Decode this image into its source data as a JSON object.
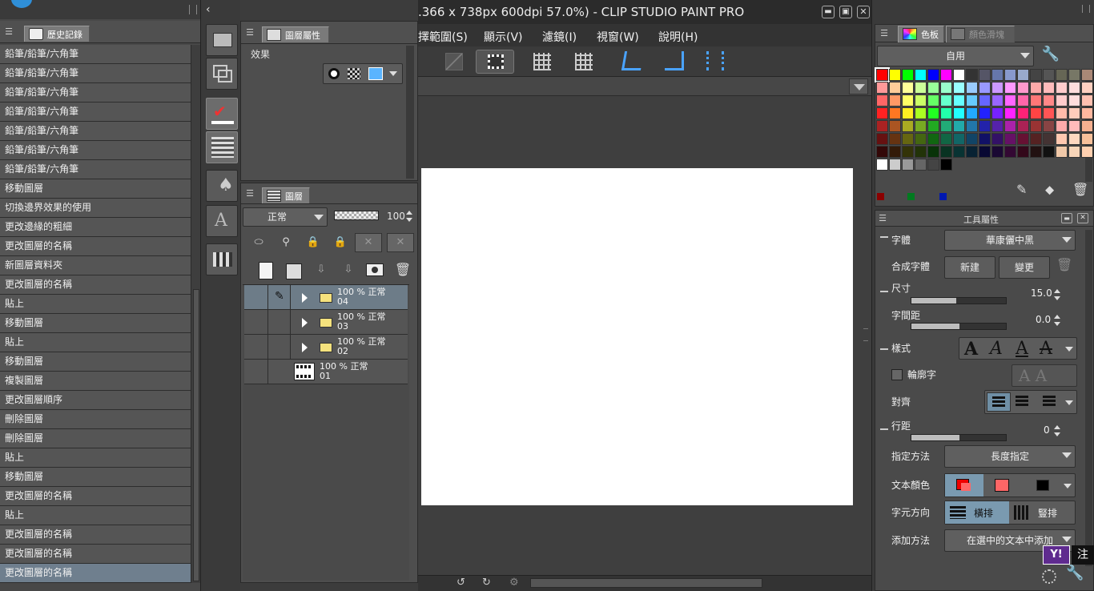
{
  "window": {
    "title": "(1366 x 738px 600dpi 57.0%) - CLIP STUDIO PAINT PRO",
    "title_visible": ".366 x 738px 600dpi 57.0%) - CLIP STUDIO PAINT PRO"
  },
  "menu": [
    "擇範圍(S)",
    "顯示(V)",
    "濾鏡(I)",
    "視窗(W)",
    "說明(H)"
  ],
  "history": {
    "tab_label": "歷史記錄",
    "items": [
      "鉛筆/鉛筆/六角筆",
      "鉛筆/鉛筆/六角筆",
      "鉛筆/鉛筆/六角筆",
      "鉛筆/鉛筆/六角筆",
      "鉛筆/鉛筆/六角筆",
      "鉛筆/鉛筆/六角筆",
      "鉛筆/鉛筆/六角筆",
      "移動圖層",
      "切換邊界效果的使用",
      "更改邊緣的粗細",
      "更改圖層的名稱",
      "新圖層資料夾",
      "更改圖層的名稱",
      "貼上",
      "移動圖層",
      "貼上",
      "移動圖層",
      "複製圖層",
      "更改圖層順序",
      "刪除圖層",
      "刪除圖層",
      "貼上",
      "移動圖層",
      "更改圖層的名稱",
      "貼上",
      "更改圖層的名稱",
      "更改圖層的名稱",
      "更改圖層的名稱"
    ],
    "selected_index": 27
  },
  "layer_property": {
    "tab_label": "圖層屬性",
    "effect_label": "效果"
  },
  "layer_panel": {
    "tab_label": "圖層",
    "blend_mode": "正常",
    "opacity": "100",
    "layers": [
      {
        "pct": "100 %",
        "mode": "正常",
        "name": "04",
        "type": "folder",
        "selected": true,
        "pen": true
      },
      {
        "pct": "100 %",
        "mode": "正常",
        "name": "03",
        "type": "folder",
        "selected": false,
        "pen": false
      },
      {
        "pct": "100 %",
        "mode": "正常",
        "name": "02",
        "type": "folder",
        "selected": false,
        "pen": false
      },
      {
        "pct": "100 %",
        "mode": "正常",
        "name": "01",
        "type": "layer",
        "selected": false,
        "pen": false
      }
    ]
  },
  "color_panel": {
    "tab_label": "色板",
    "tab2_label": "顏色滑塊",
    "preset": "自用",
    "small_swatches": [
      "#8b0000",
      "#007a1f",
      "#0018b0"
    ]
  },
  "tool_property": {
    "title": "工具屬性",
    "font_label": "字體",
    "font_value": "華康儷中黑",
    "composite_label": "合成字體",
    "new_label": "新建",
    "change_label": "變更",
    "size_label": "尺寸",
    "size_value": "15.0",
    "spacing_label": "字間距",
    "spacing_value": "0.0",
    "style_label": "樣式",
    "outline_label": "輪廓字",
    "align_label": "對齊",
    "line_spacing_label": "行距",
    "line_spacing_value": "0",
    "spec_label": "指定方法",
    "spec_value": "長度指定",
    "text_color_label": "文本顏色",
    "direction_label": "字元方向",
    "horizontal_label": "橫排",
    "vertical_label": "豎排",
    "add_method_label": "添加方法",
    "add_method_value": "在選中的文本中添加"
  },
  "overlay": {
    "badge_text": "Y!",
    "trailing_char": "注"
  }
}
